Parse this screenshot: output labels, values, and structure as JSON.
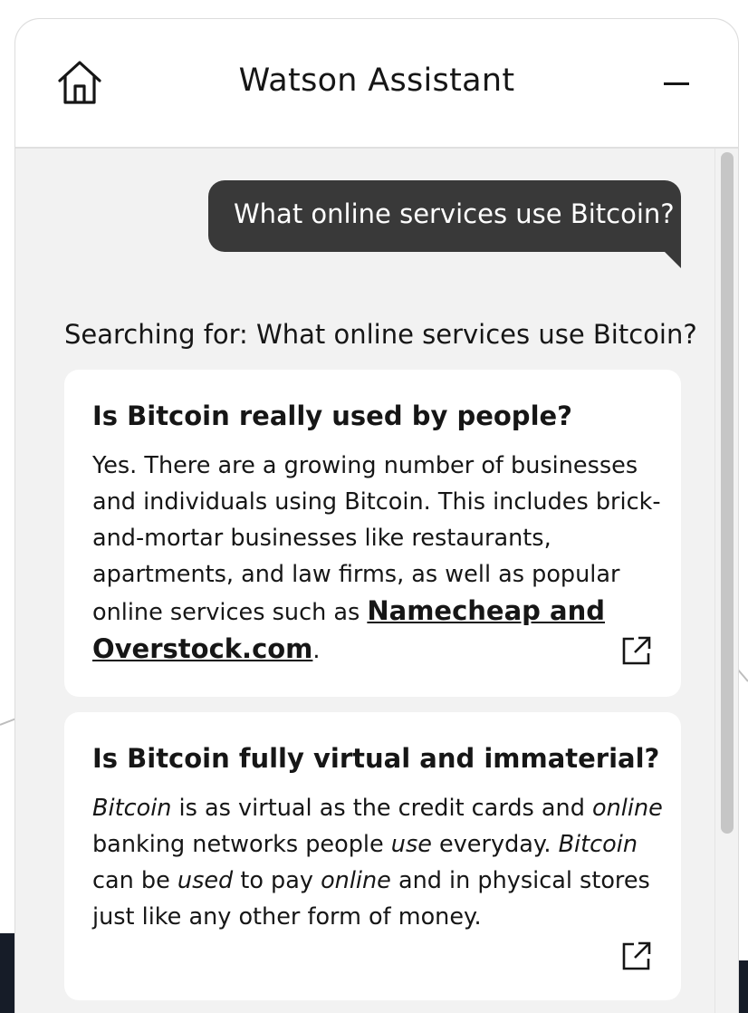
{
  "header": {
    "title": "Watson Assistant",
    "home_icon": "home-icon",
    "minimize_icon": "minimize-icon"
  },
  "conversation": {
    "user_message": "What online services use Bitcoin?",
    "search_status": "Searching for: What online services use Bitcoin?"
  },
  "results": [
    {
      "title": "Is Bitcoin really used by people?",
      "body_pre": "Yes. There are a growing number of businesses and individuals using Bitcoin. This includes brick-and-mortar businesses like restaurants, apartments, and law firms, as well as popular online services such as ",
      "link_text": "Namecheap and Overstock.com",
      "body_post": ".",
      "link_icon": "external-link-icon"
    },
    {
      "title": "Is Bitcoin fully virtual and immaterial?",
      "body_segments": [
        {
          "text": "Bitcoin",
          "italic": true
        },
        {
          "text": " is as virtual as the credit cards and ",
          "italic": false
        },
        {
          "text": "online",
          "italic": true
        },
        {
          "text": " banking networks people ",
          "italic": false
        },
        {
          "text": "use",
          "italic": true
        },
        {
          "text": " everyday. ",
          "italic": false
        },
        {
          "text": "Bitcoin",
          "italic": true
        },
        {
          "text": " can be ",
          "italic": false
        },
        {
          "text": "used",
          "italic": true
        },
        {
          "text": " to pay ",
          "italic": false
        },
        {
          "text": "online",
          "italic": true
        },
        {
          "text": " and in physical stores just like any other form of money.",
          "italic": false
        }
      ],
      "link_icon": "external-link-icon"
    }
  ],
  "colors": {
    "bubble": "#393939",
    "panel_background": "#f2f2f2",
    "card_background": "#ffffff",
    "text": "#161616",
    "page_dark": "#161c28"
  }
}
